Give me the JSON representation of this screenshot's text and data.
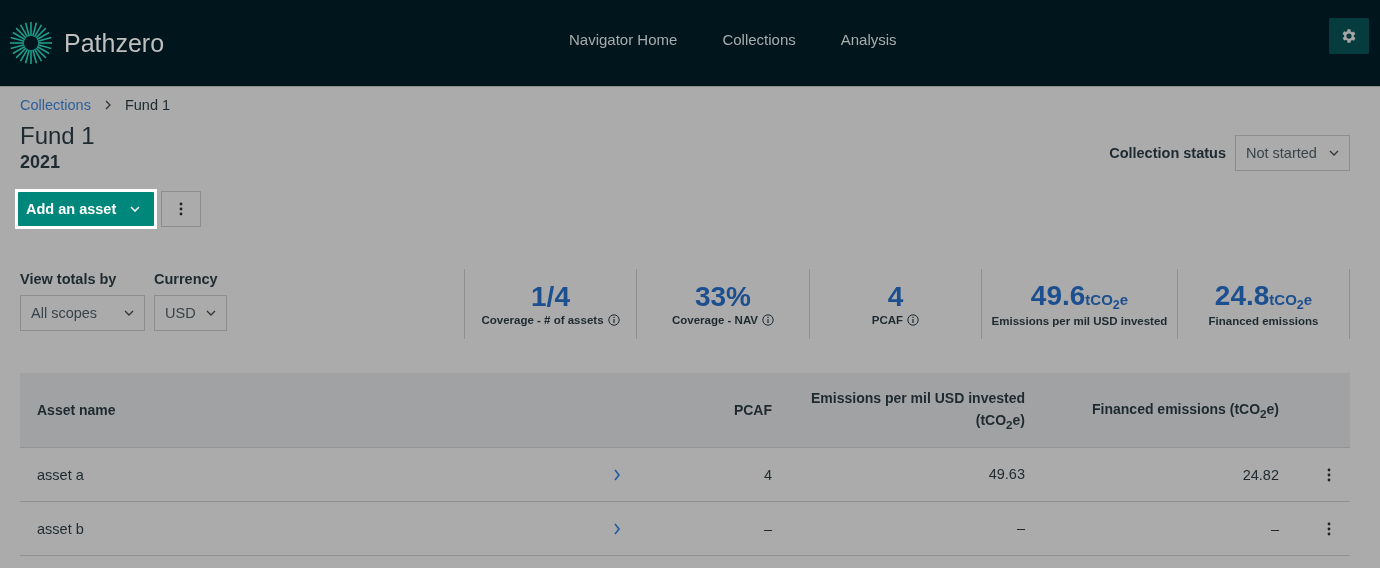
{
  "brand": {
    "name": "Pathzero"
  },
  "nav": [
    {
      "label": "Navigator Home"
    },
    {
      "label": "Collections"
    },
    {
      "label": "Analysis"
    }
  ],
  "breadcrumb": [
    {
      "label": "Collections",
      "link": true
    },
    {
      "label": "Fund 1",
      "link": false
    }
  ],
  "title": "Fund 1",
  "year": "2021",
  "collection_status": {
    "label": "Collection status",
    "value": "Not started"
  },
  "actions": {
    "primary": "Add an asset",
    "highlighted": true
  },
  "filters": [
    {
      "label": "View totals by",
      "value": "All scopes"
    },
    {
      "label": "Currency",
      "value": "USD"
    }
  ],
  "metrics": [
    {
      "value": "1/4",
      "label": "Coverage - # of assets",
      "info": true
    },
    {
      "value": "33%",
      "label": "Coverage - NAV",
      "info": true
    },
    {
      "value": "4",
      "label": "PCAF",
      "info": true
    },
    {
      "value": "49.6",
      "unit": "tCO$_{2}$e",
      "label": "Emissions per mil USD invested",
      "info": false
    },
    {
      "value": "24.8",
      "unit": "tCO$_{2}$e",
      "label": "Financed emissions",
      "info": false
    }
  ],
  "table": {
    "columns": [
      "Asset name",
      "PCAF",
      "Emissions per mil USD invested (tCO$_{2}$e)",
      "Financed emissions (tCO$_{2}$e)"
    ],
    "rows": [
      {
        "name": "asset a",
        "pcaf": "4",
        "emissions": "49.63",
        "financed": "24.82"
      },
      {
        "name": "asset b",
        "pcaf": "–",
        "emissions": "–",
        "financed": "–"
      }
    ]
  }
}
